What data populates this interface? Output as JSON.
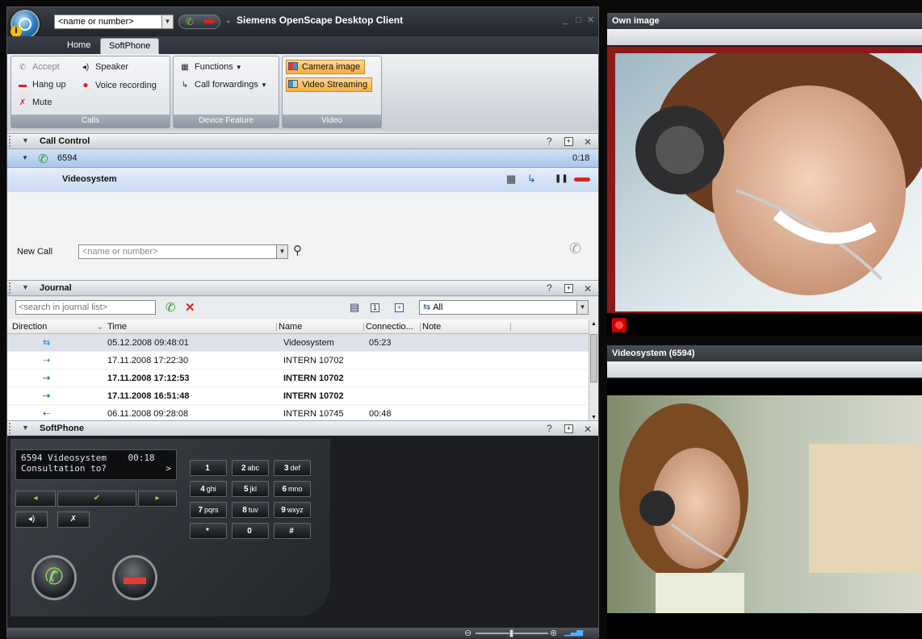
{
  "window": {
    "title": "Siemens OpenScape Desktop Client",
    "dial_placeholder": "<name or number>"
  },
  "ribbon": {
    "tabs": [
      "Home",
      "SoftPhone"
    ],
    "active_tab": "SoftPhone",
    "calls": {
      "accept": "Accept",
      "speaker": "Speaker",
      "hangup": "Hang up",
      "voice_recording": "Voice recording",
      "mute": "Mute",
      "label": "Calls"
    },
    "device": {
      "functions": "Functions",
      "call_forwardings": "Call forwardings",
      "label": "Device Feature"
    },
    "video": {
      "camera_image": "Camera image",
      "video_streaming": "Video Streaming",
      "label": "Video"
    }
  },
  "call_control": {
    "title": "Call Control",
    "number": "6594",
    "duration": "0:18",
    "name": "Videosystem",
    "new_call_label": "New Call",
    "new_call_placeholder": "<name or number>"
  },
  "journal": {
    "title": "Journal",
    "search_placeholder": "<search in journal list>",
    "filter": "All",
    "columns": [
      "Direction",
      "Time",
      "Name",
      "Connectio...",
      "Note"
    ],
    "rows": [
      {
        "time": "05.12.2008 09:48:01",
        "name": "Videosystem",
        "connection": "05:23",
        "bold": false,
        "selected": true,
        "type": "in"
      },
      {
        "time": "17.11.2008 17:22:30",
        "name": "INTERN 10702",
        "connection": "",
        "bold": false,
        "selected": false,
        "type": "missed"
      },
      {
        "time": "17.11.2008 17:12:53",
        "name": "INTERN 10702",
        "connection": "",
        "bold": true,
        "selected": false,
        "type": "missed"
      },
      {
        "time": "17.11.2008 16:51:48",
        "name": "INTERN 10702",
        "connection": "",
        "bold": true,
        "selected": false,
        "type": "missed"
      },
      {
        "time": "06.11.2008 09:28:08",
        "name": "INTERN 10745",
        "connection": "00:48",
        "bold": false,
        "selected": false,
        "type": "out"
      }
    ]
  },
  "softphone": {
    "title": "SoftPhone",
    "display_line1": "6594 Videosystem    00:18",
    "display_line2": "Consultation to?",
    "display_arrow": ">",
    "keys": [
      {
        "d": "1",
        "l": ""
      },
      {
        "d": "2",
        "l": "abc"
      },
      {
        "d": "3",
        "l": "def"
      },
      {
        "d": "4",
        "l": "ghi"
      },
      {
        "d": "5",
        "l": "jkl"
      },
      {
        "d": "6",
        "l": "mno"
      },
      {
        "d": "7",
        "l": "pqrs"
      },
      {
        "d": "8",
        "l": "tuv"
      },
      {
        "d": "9",
        "l": "wxyz"
      },
      {
        "d": "*",
        "l": ""
      },
      {
        "d": "0",
        "l": ""
      },
      {
        "d": "#",
        "l": ""
      }
    ]
  },
  "panes": {
    "own_image": "Own image",
    "remote": "Videosystem (6594)"
  }
}
